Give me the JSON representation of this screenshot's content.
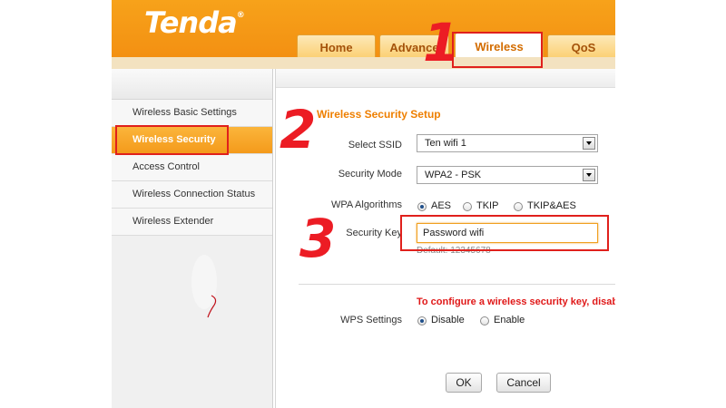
{
  "brand": {
    "logo_text": "Tenda",
    "reg_mark": "®"
  },
  "tabs": [
    {
      "label": "Home",
      "active": false
    },
    {
      "label": "Advance",
      "active": false
    },
    {
      "label": "Wireless",
      "active": true
    },
    {
      "label": "QoS",
      "active": false
    }
  ],
  "sidebar": {
    "items": [
      {
        "label": "Wireless Basic Settings",
        "active": false
      },
      {
        "label": "Wireless Security",
        "active": true
      },
      {
        "label": "Access Control",
        "active": false
      },
      {
        "label": "Wireless Connection Status",
        "active": false
      },
      {
        "label": "Wireless Extender",
        "active": false
      }
    ]
  },
  "main": {
    "section_title": "Wireless Security Setup",
    "select_ssid": {
      "label": "Select SSID",
      "value": "Ten wifi 1"
    },
    "security_mode": {
      "label": "Security Mode",
      "value": "WPA2 - PSK"
    },
    "wpa_algorithms": {
      "label": "WPA Algorithms",
      "options": [
        {
          "label": "AES",
          "checked": true
        },
        {
          "label": "TKIP",
          "checked": false
        },
        {
          "label": "TKIP&AES",
          "checked": false
        }
      ]
    },
    "security_key": {
      "label": "Security Key",
      "value": "Password wifi",
      "hint": "Default: 12345678"
    },
    "warning": "To configure a wireless security key, disable",
    "wps": {
      "label": "WPS Settings",
      "options": [
        {
          "label": "Disable",
          "checked": true
        },
        {
          "label": "Enable",
          "checked": false
        }
      ]
    },
    "ok_label": "OK",
    "cancel_label": "Cancel"
  },
  "annotations": {
    "step1": "1",
    "step2": "2",
    "step3": "3"
  },
  "colors": {
    "brand_orange": "#f39012",
    "annotation_red": "#e0201c",
    "section_title": "#ee7f00"
  }
}
